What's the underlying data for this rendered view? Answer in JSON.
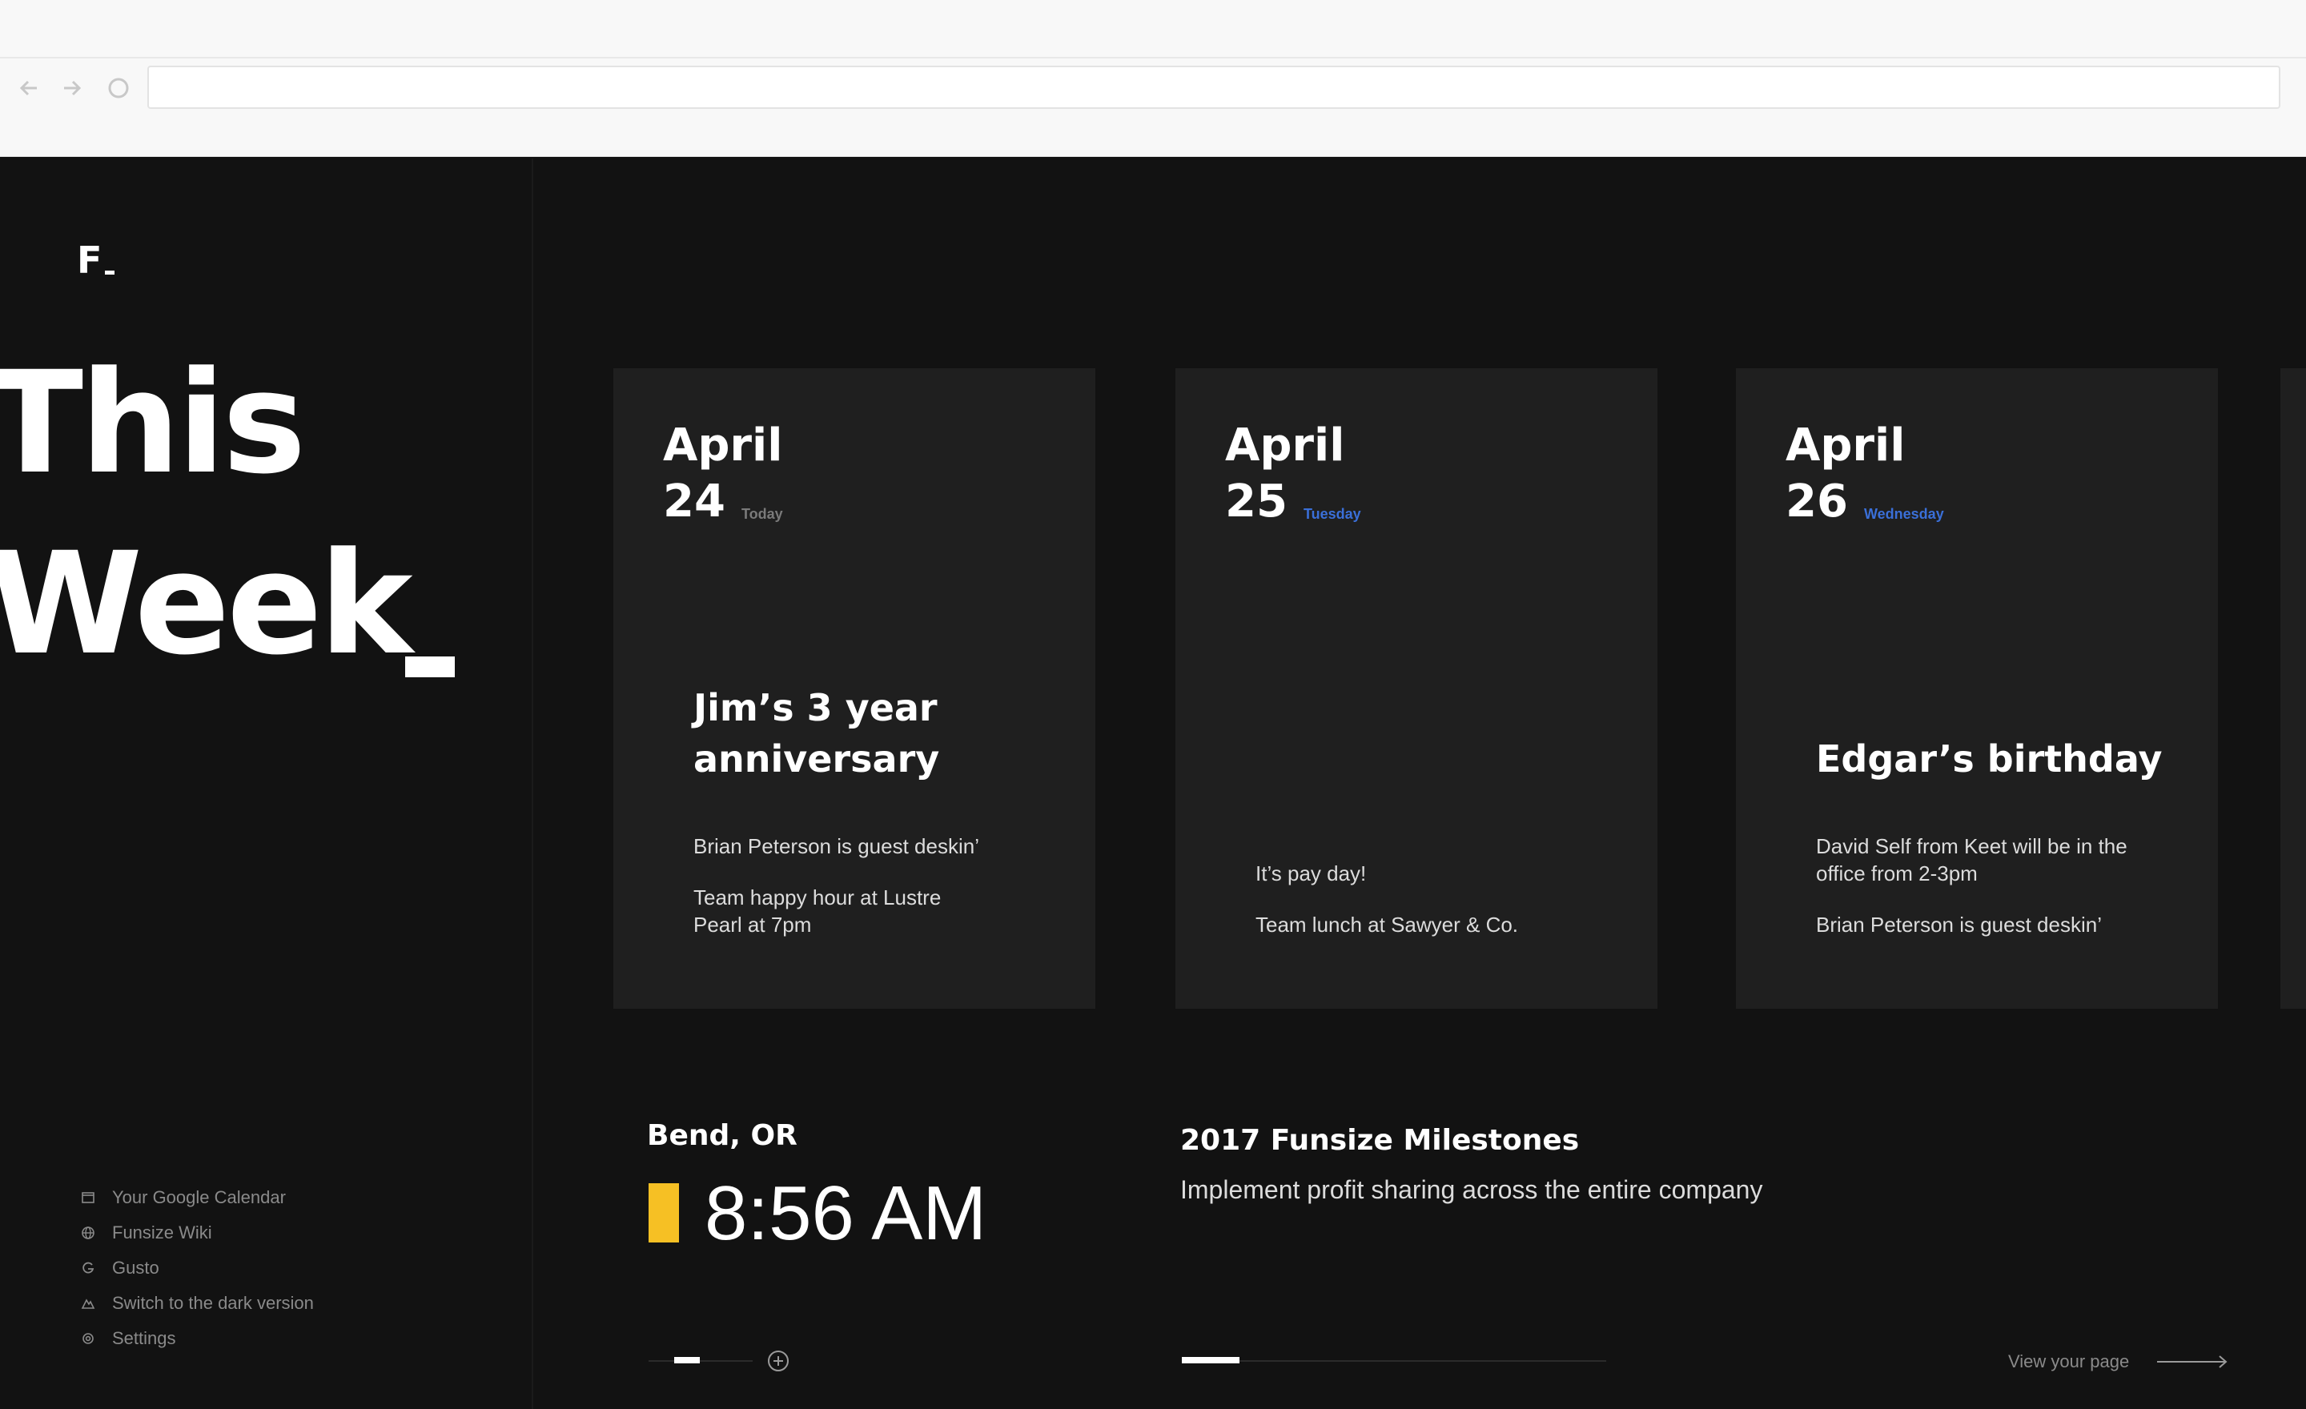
{
  "browser": {
    "address": "",
    "icons": [
      "back-arrow-icon",
      "forward-arrow-icon",
      "reload-icon"
    ]
  },
  "sidebar": {
    "logo": "F",
    "headline_line1": "This",
    "headline_line2": "Week",
    "links": [
      {
        "label": "Your Google Calendar",
        "icon": "calendar-icon"
      },
      {
        "label": "Funsize Wiki",
        "icon": "globe-icon"
      },
      {
        "label": "Gusto",
        "icon": "gusto-icon"
      },
      {
        "label": "Switch to the dark version",
        "icon": "mountain-icon"
      },
      {
        "label": "Settings",
        "icon": "gear-icon"
      }
    ]
  },
  "days": [
    {
      "month": "April",
      "day": "24",
      "day_name": "Today",
      "event_title": "Jim’s 3 year anniversary",
      "items": [
        "Brian Peterson is guest deskin’",
        "Team happy hour at Lustre Pearl at 7pm"
      ]
    },
    {
      "month": "April",
      "day": "25",
      "day_name": "Tuesday",
      "event_title": "",
      "items": [
        "It’s pay day!",
        "Team lunch at Sawyer & Co."
      ]
    },
    {
      "month": "April",
      "day": "26",
      "day_name": "Wednesday",
      "event_title": "Edgar’s birthday",
      "items": [
        "David Self from Keet will be in the office from 2-3pm",
        "Brian Peterson is guest deskin’"
      ]
    }
  ],
  "clock": {
    "location": "Bend, OR",
    "time": "8:56 AM",
    "accent": "#f6c024"
  },
  "milestones": {
    "title": "2017 Funsize Milestones",
    "text": "Implement profit sharing across the entire company"
  },
  "footer": {
    "view_page": "View your page"
  },
  "colors": {
    "background": "#121212",
    "card": "#1f1f1f",
    "weekday_blue": "#3a6fd8",
    "muted": "#8a8a8a"
  }
}
